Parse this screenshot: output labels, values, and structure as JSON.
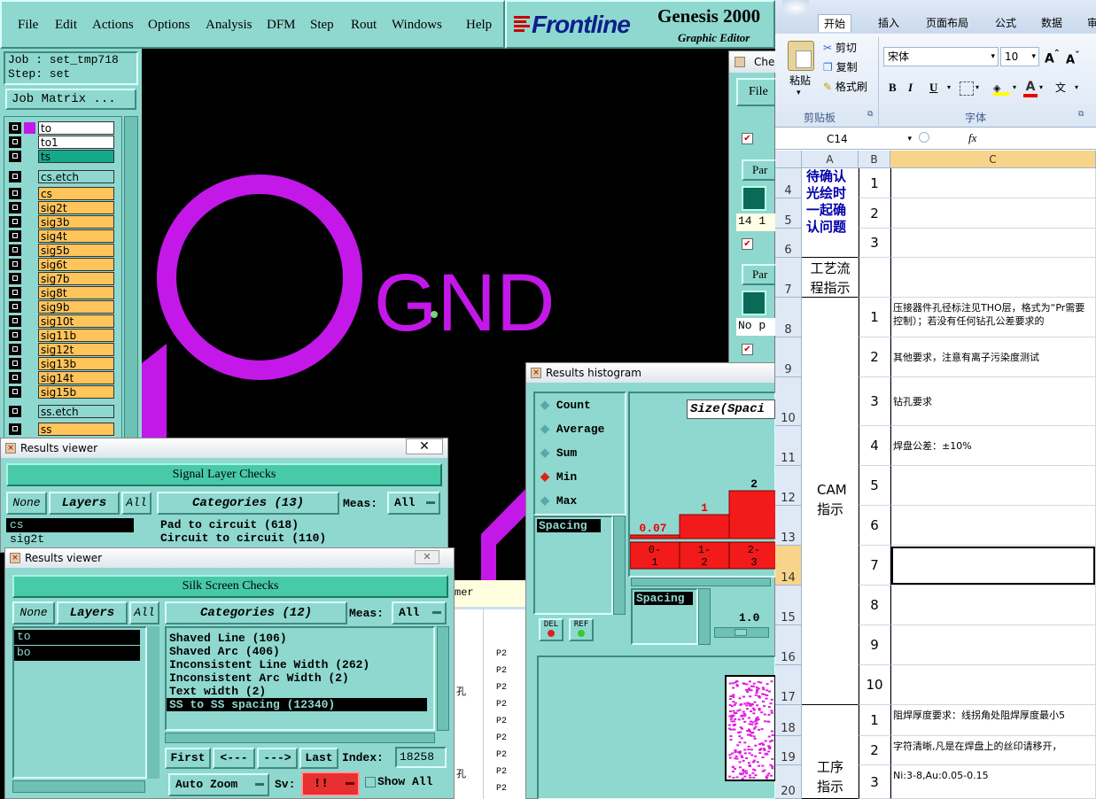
{
  "menubar": {
    "items": [
      "File",
      "Edit",
      "Actions",
      "Options",
      "Analysis",
      "DFM",
      "Step",
      "Rout",
      "Windows",
      "Help"
    ],
    "brand": "Frontline",
    "product": "Genesis 2000",
    "subtitle": "Graphic Editor"
  },
  "job": {
    "job_label": "Job : set_tmp718",
    "step_label": "Step: set",
    "matrix_button": "Job Matrix ..."
  },
  "layers": [
    "to",
    "to1",
    "ts",
    "cs.etch",
    "cs",
    "sig2t",
    "sig3b",
    "sig4t",
    "sig5b",
    "sig6t",
    "sig7b",
    "sig8t",
    "sig9b",
    "sig10t",
    "sig11b",
    "sig12t",
    "sig13b",
    "sig14t",
    "sig15b",
    "ss.etch",
    "ss"
  ],
  "canvas": {
    "label": "GND"
  },
  "results_viewer_1": {
    "title": "Results viewer",
    "header": "Signal Layer Checks",
    "none": "None",
    "layers": "Layers",
    "all": "All",
    "categories": "Categories (13)",
    "meas_label": "Meas:",
    "meas_value": "All",
    "layer_list": [
      "cs",
      "sig2t"
    ],
    "cat_list": [
      "Pad to circuit (618)",
      "Circuit to circuit (110)"
    ]
  },
  "results_viewer_2": {
    "title": "Results viewer",
    "header": "Silk Screen Checks",
    "none": "None",
    "layers": "Layers",
    "all": "All",
    "categories": "Categories (12)",
    "meas_label": "Meas:",
    "meas_value": "All",
    "layer_list": [
      "to",
      "bo"
    ],
    "cat_list": [
      "Shaved Line (106)",
      "Shaved Arc (406)",
      "Inconsistent Line Width (262)",
      "Inconsistent Arc Width (2)",
      "Text width (2)",
      "SS to SS spacing (12340)"
    ],
    "selected_cat": 5,
    "first": "First",
    "prev": "<---",
    "next": "--->",
    "last": "Last",
    "index_label": "Index:",
    "index_value": "18258",
    "auto_zoom": "Auto Zoom",
    "sv_label": "Sv:",
    "sv_value": "!!",
    "show_all": "Show All"
  },
  "histogram": {
    "title": "Results histogram",
    "options": [
      "Count",
      "Average",
      "Sum",
      "Min",
      "Max"
    ],
    "selected": "Min",
    "size_label": "Size(Spaci",
    "list_item": "Spacing",
    "field_item": "Spacing",
    "del": "DEL",
    "ref": "REF",
    "scale_value": "1.0",
    "bins": [
      "0-1",
      "1-2",
      "2-3"
    ],
    "bar_labels": [
      "0.07",
      "1",
      "2"
    ],
    "bar_values": [
      0.07,
      1,
      2
    ]
  },
  "check_window": {
    "title": "Che",
    "file": "File",
    "par1": "Par",
    "par2": "Par",
    "value_14": "14 1",
    "no_p": "No p"
  },
  "behind_text": {
    "mer": "mer",
    "p2": "P2",
    "kong": "孔"
  },
  "excel": {
    "tabs": [
      "开始",
      "插入",
      "页面布局",
      "公式",
      "数据",
      "审"
    ],
    "active_tab": "开始",
    "paste": "粘贴",
    "cut": "剪切",
    "copy": "复制",
    "format_painter": "格式刷",
    "clipboard_group": "剪贴板",
    "font_group": "字体",
    "font_name": "宋体",
    "font_size": "10",
    "bold": "B",
    "italic": "I",
    "underline": "U",
    "name_box": "C14",
    "fx": "fx",
    "col_headers": [
      "A",
      "B",
      "C"
    ],
    "rows": [
      {
        "n": "4",
        "b": "1",
        "c": ""
      },
      {
        "n": "5",
        "b": "2",
        "c": ""
      },
      {
        "n": "6",
        "b": "3",
        "c": ""
      },
      {
        "n": "7",
        "b": "",
        "c": ""
      },
      {
        "n": "8",
        "b": "1",
        "c": "压接器件孔径标注见THO层，格式为“Pr需要控制）；若没有任何钻孔公差要求的"
      },
      {
        "n": "9",
        "b": "2",
        "c": "其他要求，注意有离子污染度测试"
      },
      {
        "n": "10",
        "b": "3",
        "c": "钻孔要求"
      },
      {
        "n": "11",
        "b": "4",
        "c": "焊盘公差：±10%"
      },
      {
        "n": "12",
        "b": "5",
        "c": ""
      },
      {
        "n": "13",
        "b": "6",
        "c": ""
      },
      {
        "n": "14",
        "b": "7",
        "c": ""
      },
      {
        "n": "15",
        "b": "8",
        "c": ""
      },
      {
        "n": "16",
        "b": "9",
        "c": ""
      },
      {
        "n": "17",
        "b": "10",
        "c": ""
      },
      {
        "n": "18",
        "b": "1",
        "c": "阻焊厚度要求：线拐角处阻焊厚度最小5"
      },
      {
        "n": "19",
        "b": "2",
        "c": "字符清晰,凡是在焊盘上的丝印请移开，"
      },
      {
        "n": "20",
        "b": "3",
        "c": "Ni:3-8,Au:0.05-0.15"
      }
    ],
    "a_pending": "待确认光绘时一起确认问题",
    "a_process": "工艺流程指示",
    "a_cam": "CAM指示",
    "a_procedure": "工序指示"
  }
}
